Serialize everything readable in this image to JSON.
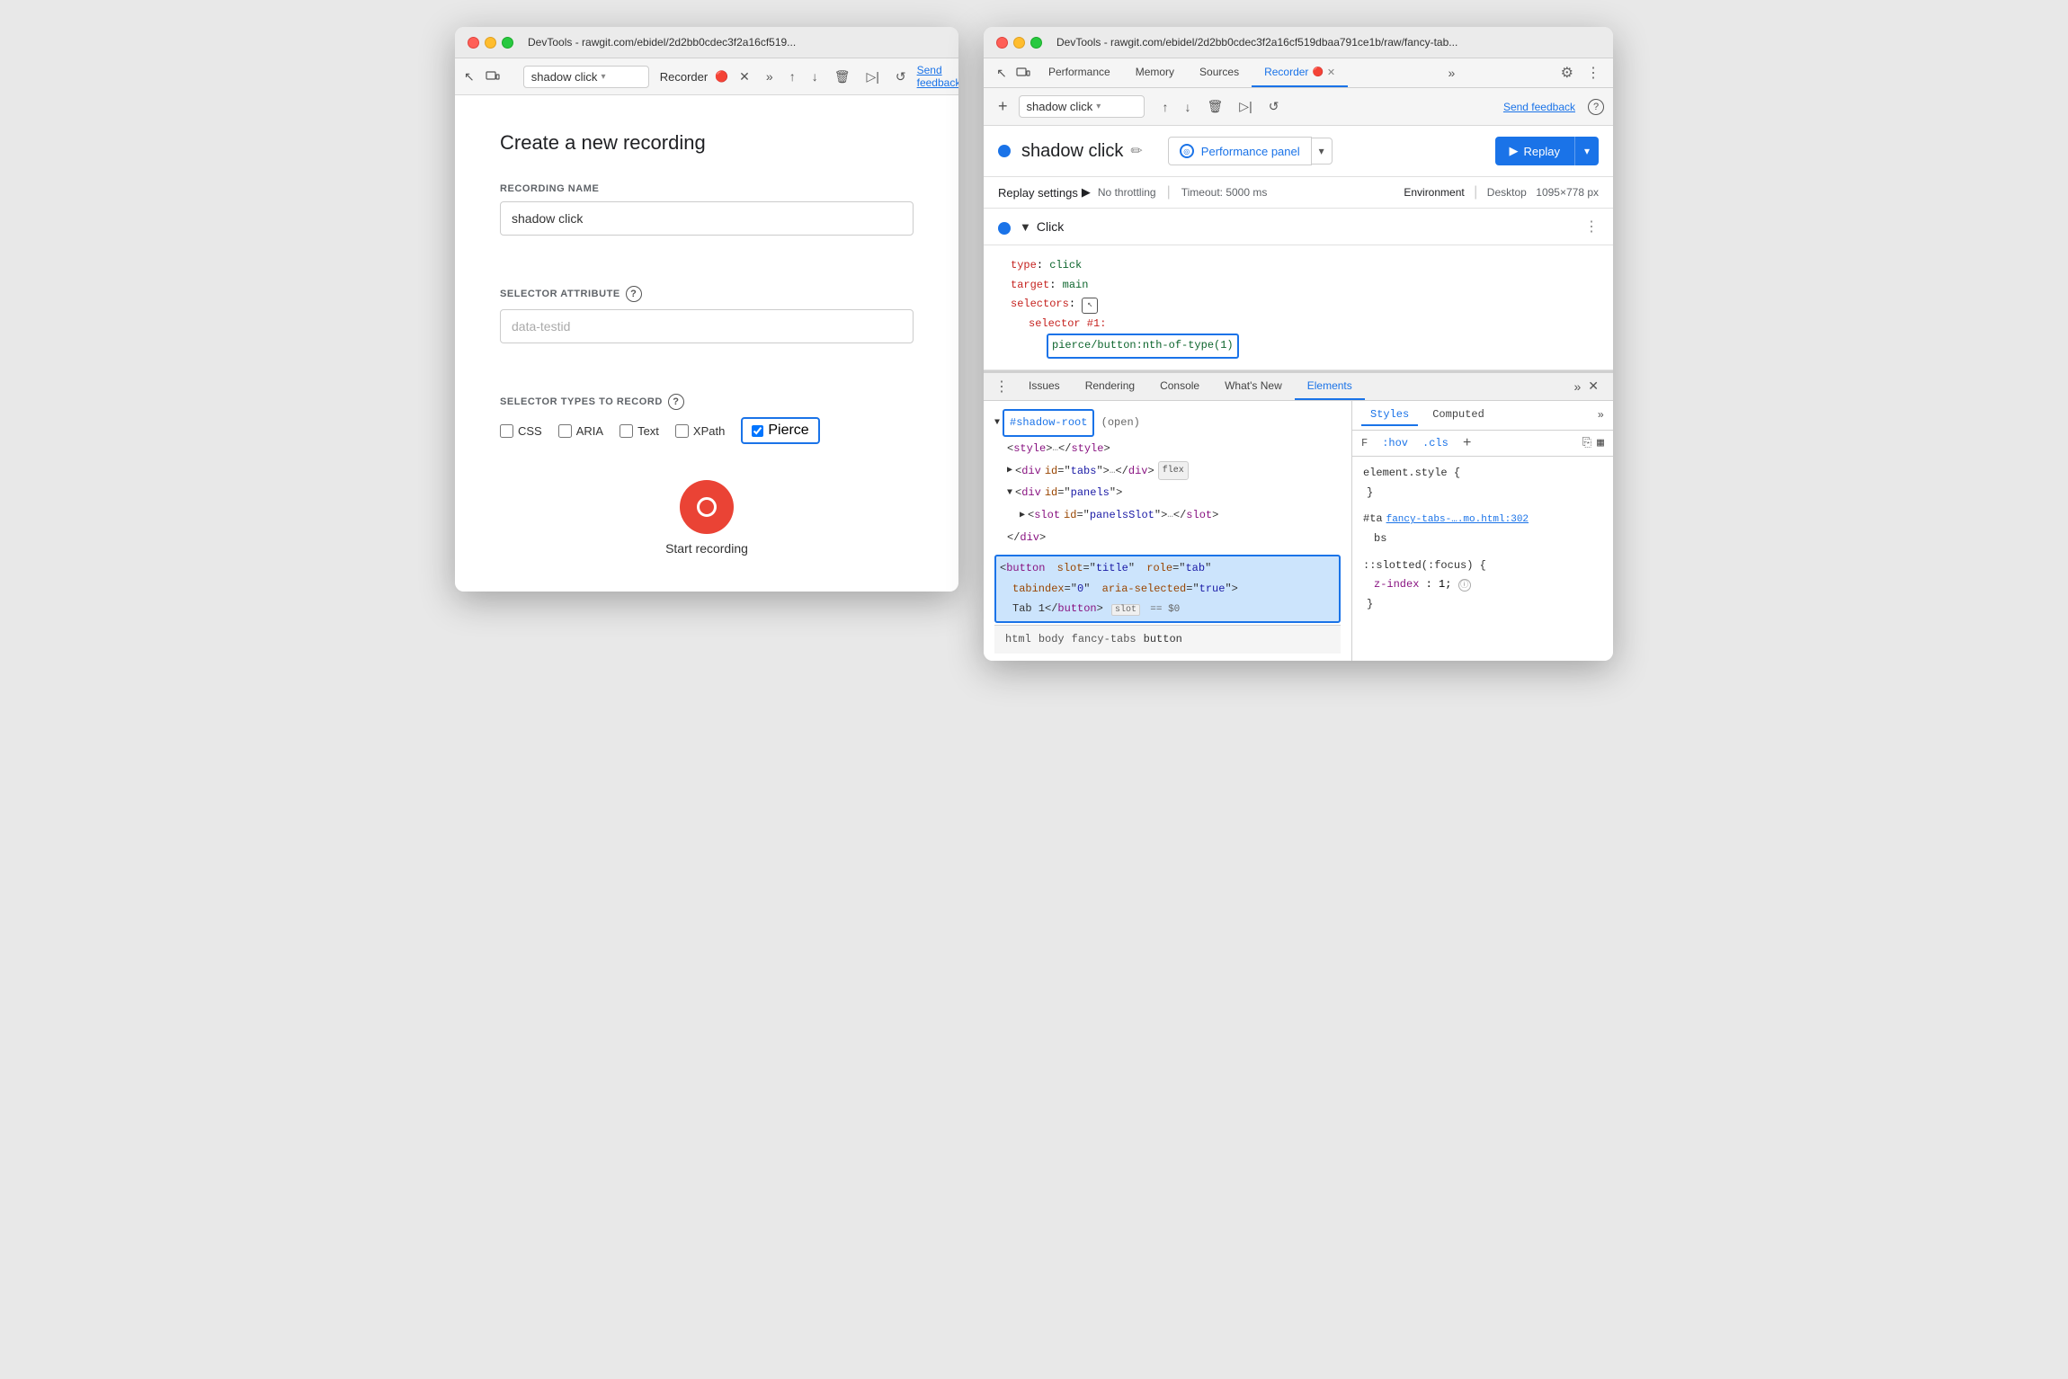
{
  "leftWindow": {
    "titleBar": "DevTools - rawgit.com/ebidel/2d2bb0cdec3f2a16cf519...",
    "tab": "Recorder",
    "addIcon": "+",
    "recordingName": "shadow click",
    "pageTitle": "Create a new recording",
    "recordingNameLabel": "RECORDING NAME",
    "recordingNameValue": "shadow click",
    "selectorAttrLabel": "SELECTOR ATTRIBUTE",
    "selectorAttrPlaceholder": "data-testid",
    "selectorTypesLabel": "SELECTOR TYPES TO RECORD",
    "checkboxes": {
      "css": {
        "label": "CSS",
        "checked": false
      },
      "aria": {
        "label": "ARIA",
        "checked": false
      },
      "text": {
        "label": "Text",
        "checked": false
      },
      "xpath": {
        "label": "XPath",
        "checked": false
      },
      "pierce": {
        "label": "Pierce",
        "checked": true
      }
    },
    "startRecordingLabel": "Start recording",
    "sendFeedback": "Send feedback"
  },
  "rightWindow": {
    "titleBar": "DevTools - rawgit.com/ebidel/2d2bb0cdec3f2a16cf519dbaa791ce1b/raw/fancy-tab...",
    "topTabs": [
      "Performance",
      "Memory",
      "Sources",
      "Recorder",
      ""
    ],
    "activeTab": "Recorder",
    "toolbar": {
      "addIcon": "+",
      "recordingName": "shadow click",
      "sendFeedback": "Send feedback"
    },
    "header": {
      "blueDot": true,
      "title": "shadow click",
      "performancePanelLabel": "Performance panel",
      "replayLabel": "Replay"
    },
    "replaySettings": {
      "title": "Replay settings",
      "arrow": "▶",
      "throttling": "No throttling",
      "timeout": "Timeout: 5000 ms",
      "envTitle": "Environment",
      "envDetail": "Desktop",
      "resolution": "1095×778 px"
    },
    "clickStep": {
      "title": "Click",
      "code": {
        "type": "type: click",
        "target": "target: main",
        "selectors": "selectors:",
        "selectorNum": "selector #1:",
        "selectorVal": "pierce/button:nth-of-type(1)"
      }
    },
    "bottomTabs": [
      "Issues",
      "Rendering",
      "Console",
      "What's New",
      "Elements"
    ],
    "activeBottomTab": "Elements",
    "domTree": {
      "line1": "▼ #shadow-root",
      "line1b": "(open)",
      "line2": "<style>",
      "line2b": "…",
      "line2c": "</style>",
      "line3a": "▶",
      "line3b": "<div id=\"tabs\">",
      "line3c": "…",
      "line3d": "</div>",
      "line3e": "flex",
      "line4a": "▼",
      "line4b": "<div id=\"panels\">",
      "line5a": "▶",
      "line5b": "<slot id=\"panelsSlot\">",
      "line5c": "…",
      "line5d": "</slot>",
      "line6": "</div>",
      "selectedLine": "<button slot=\"title\" role=\"tab\"\n    tabindex=\"0\" aria-selected=\"true\">\n    Tab 1</button>",
      "selectedBadge": "slot",
      "selectedDollar": "== $0"
    },
    "breadcrumbs": [
      "html",
      "body",
      "fancy-tabs",
      "button"
    ],
    "stylesPanel": {
      "tabs": [
        "Styles",
        "Computed"
      ],
      "activeTab": "Styles",
      "filterLabel": "F",
      "hov": ":hov",
      "cls": ".cls",
      "plus": "+",
      "elementStyle": "element.style {",
      "closeBrace": "}",
      "rule1selector": "#ta",
      "rule1source": "fancy-tabs-….mo.html:302",
      "rule1content": "bs",
      "pseudoContent": "::slotted(:focus) {",
      "rule1prop": "z-index:",
      "rule1val": " 1;",
      "infoCircle": "ⓘ",
      "closeBrace2": "}"
    }
  }
}
